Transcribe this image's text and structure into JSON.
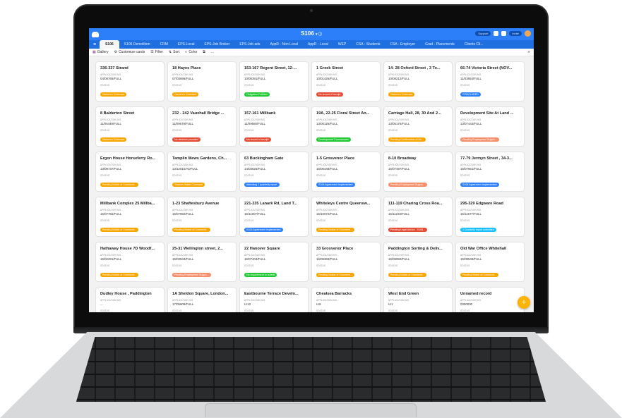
{
  "app": {
    "base_title": "S106",
    "base_title_suffix": "▾ ⓘ",
    "support_label": "Support",
    "toolbar_right_extra": "Invite"
  },
  "tabs": [
    "S106",
    "S106 Demolition",
    "CRM",
    "EPS-Local",
    "EPS-Job Broker",
    "EPS-Job ads",
    "AppR - Non Local",
    "AppR - Local",
    "WEP",
    "CSA - Students",
    "CSA - Employer",
    "Grad - Placements",
    "Clients Cli..."
  ],
  "viewbar": {
    "view_name": "Gallery",
    "customize": "Customize cards",
    "filter": "Filter",
    "sort": "Sort",
    "color": "Color",
    "more": "..."
  },
  "field_labels": {
    "app_no": "APPLICATION NO.",
    "status": "STATUS"
  },
  "colors": {
    "orange": "#f7a600",
    "red": "#e54b33",
    "green": "#20c933",
    "blue": "#2d7ff9",
    "teal": "#18bfff",
    "salmon": "#f58f6a"
  },
  "cards": [
    {
      "title": "336-337 Strand",
      "app_no": "04/08766/FULL",
      "status": "Owners's Covenant",
      "color": "#f7a600"
    },
    {
      "title": "18 Hayes Place",
      "app_no": "07/03696/FULL",
      "status": "Owners's Covenant",
      "color": "#f7a600"
    },
    {
      "title": "153-167 Regent Street, 12-...",
      "app_no": "10/00391/FULL",
      "status": "Obligation Fulfilled",
      "color": "#20c933"
    },
    {
      "title": "1 Greek Street",
      "app_no": "10/01426/FULL",
      "status": "No record of receipt",
      "color": "#e54b33"
    },
    {
      "title": "14- 28 Oxford Street , 3 To...",
      "app_no": "10/08212/FULL",
      "status": "Owners's Covenant",
      "color": "#f7a600"
    },
    {
      "title": "66-74 Victoria Street (NOV...",
      "app_no": "11/03854/FULL",
      "status": "CONCLUDED",
      "color": "#2d7ff9"
    },
    {
      "title": "8 Balderton Street",
      "app_no": "11/06449/FULL",
      "status": "Owners's Covenant",
      "color": "#f7a600"
    },
    {
      "title": "232 - 242 Vauxhall Bridge ...",
      "app_no": "11/09679/FULL",
      "status": "No decision provided",
      "color": "#e54b33"
    },
    {
      "title": "157-161 Millbank",
      "app_no": "11/09680/FULL",
      "status": "No record of receipt",
      "color": "#e54b33"
    },
    {
      "title": "19A, 22-25 Floral Street An...",
      "app_no": "13/00126/FULL",
      "status": "Development Commenced",
      "color": "#20c933"
    },
    {
      "title": "Carriage Hall, 28, 30 And 2...",
      "app_no": "13/05176/FULL",
      "status": "Pending Confirmation of Ac...",
      "color": "#f7a600"
    },
    {
      "title": "Development Site At Land ...",
      "app_no": "13/07443/FULL",
      "status": "Pending Employment Suppo...",
      "color": "#f58f6a"
    },
    {
      "title": "Ergon House Horseferry Ro...",
      "app_no": "13/09737/FULL",
      "status": "Pending Notice of Comment...",
      "color": "#f7a600"
    },
    {
      "title": "Tamplin Mews Gardens, Ch...",
      "app_no": "13/12015/ADFULL",
      "status": "Thames Water Covenant",
      "color": "#f7a600"
    },
    {
      "title": "63 Buckingham Gate",
      "app_no": "14/03625/FULL",
      "status": "Attending 1 quarterly report",
      "color": "#2d7ff9"
    },
    {
      "title": "1-5 Grosvenor Place",
      "app_no": "15/06448/FULL",
      "status": "S106 Agreement Implemented",
      "color": "#2d7ff9"
    },
    {
      "title": "8-10 Broadway",
      "app_no": "15/07497/FULL",
      "status": "Pending Employment Suppo...",
      "color": "#f58f6a"
    },
    {
      "title": "77-79 Jermyn Street , 34-3...",
      "app_no": "15/07661/FULL",
      "status": "S106 Agreement Implemented",
      "color": "#2d7ff9"
    },
    {
      "title": "Millbank Complex 25 Millba...",
      "app_no": "15/07756/FULL",
      "status": "Pending Notice of Comment...",
      "color": "#f7a600"
    },
    {
      "title": "1-23 Shaftesbury Avenue",
      "app_no": "15/07992/FULL",
      "status": "Pending Notice of Comment...",
      "color": "#f7a600"
    },
    {
      "title": "221-235 Lanark Rd, Land T...",
      "app_no": "15/11007/FULL",
      "status": "S106 Agreement Implemented",
      "color": "#2d7ff9"
    },
    {
      "title": "Whiteleys Centre Queensw...",
      "app_no": "15/10072/FULL",
      "status": "Pending Notice of Comment...",
      "color": "#f7a600"
    },
    {
      "title": "111-119 Charing Cross Roa...",
      "app_no": "15/11234/FULL",
      "status": "Pending Legal Advice - S106...",
      "color": "#e54b33"
    },
    {
      "title": "295-329 Edgware Road",
      "app_no": "15/11677/FULL",
      "status": "1 Quarterly report submitted",
      "color": "#18bfff"
    },
    {
      "title": "Hathaway House 7D Woodf...",
      "app_no": "16/02291/FULL",
      "status": "Pending Notice of Comment...",
      "color": "#f7a600"
    },
    {
      "title": "25-31 Wellington street, 2...",
      "app_no": "16/03534/FULL",
      "status": "Pending Employment Suppo...",
      "color": "#f58f6a"
    },
    {
      "title": "22 Hanover Square",
      "app_no": "16/07404/FULL",
      "status": "No requirement to submit",
      "color": "#20c933"
    },
    {
      "title": "33 Grosvenor Place",
      "app_no": "16/08369/FULL",
      "status": "Pending Notice of Comment...",
      "color": "#f7a600"
    },
    {
      "title": "Paddington Sorting & Deliv...",
      "app_no": "16/09050/FULL",
      "status": "Pending Notice of Comment...",
      "color": "#f7a600"
    },
    {
      "title": "Old War Office Whitehall",
      "app_no": "16/09548/FULL",
      "status": "Pending Notice of Comment...",
      "color": "#f7a600"
    },
    {
      "title": "Dudley House , Paddington",
      "app_no": "...",
      "status": "",
      "color": "#ffffff"
    },
    {
      "title": "1A Sheldon Square, London...",
      "app_no": "17/05609/FULL",
      "status": "Pending Confirmation of Ac...",
      "color": "#f7a600"
    },
    {
      "title": "Eastbourne Terrace Develo...",
      "app_no": "IA10",
      "status": "Pending Employment Suppo...",
      "color": "#f58f6a"
    },
    {
      "title": "Chealsea Barracks",
      "app_no": "IA8",
      "status": "Pending Employment Suppo...",
      "color": "#f58f6a"
    },
    {
      "title": "West End Green",
      "app_no": "IA1",
      "status": "",
      "color": "#ffffff"
    },
    {
      "title": "Unnamed record",
      "app_no": "0000000",
      "status": "",
      "color": "#ffffff"
    }
  ],
  "fab_label": "+"
}
